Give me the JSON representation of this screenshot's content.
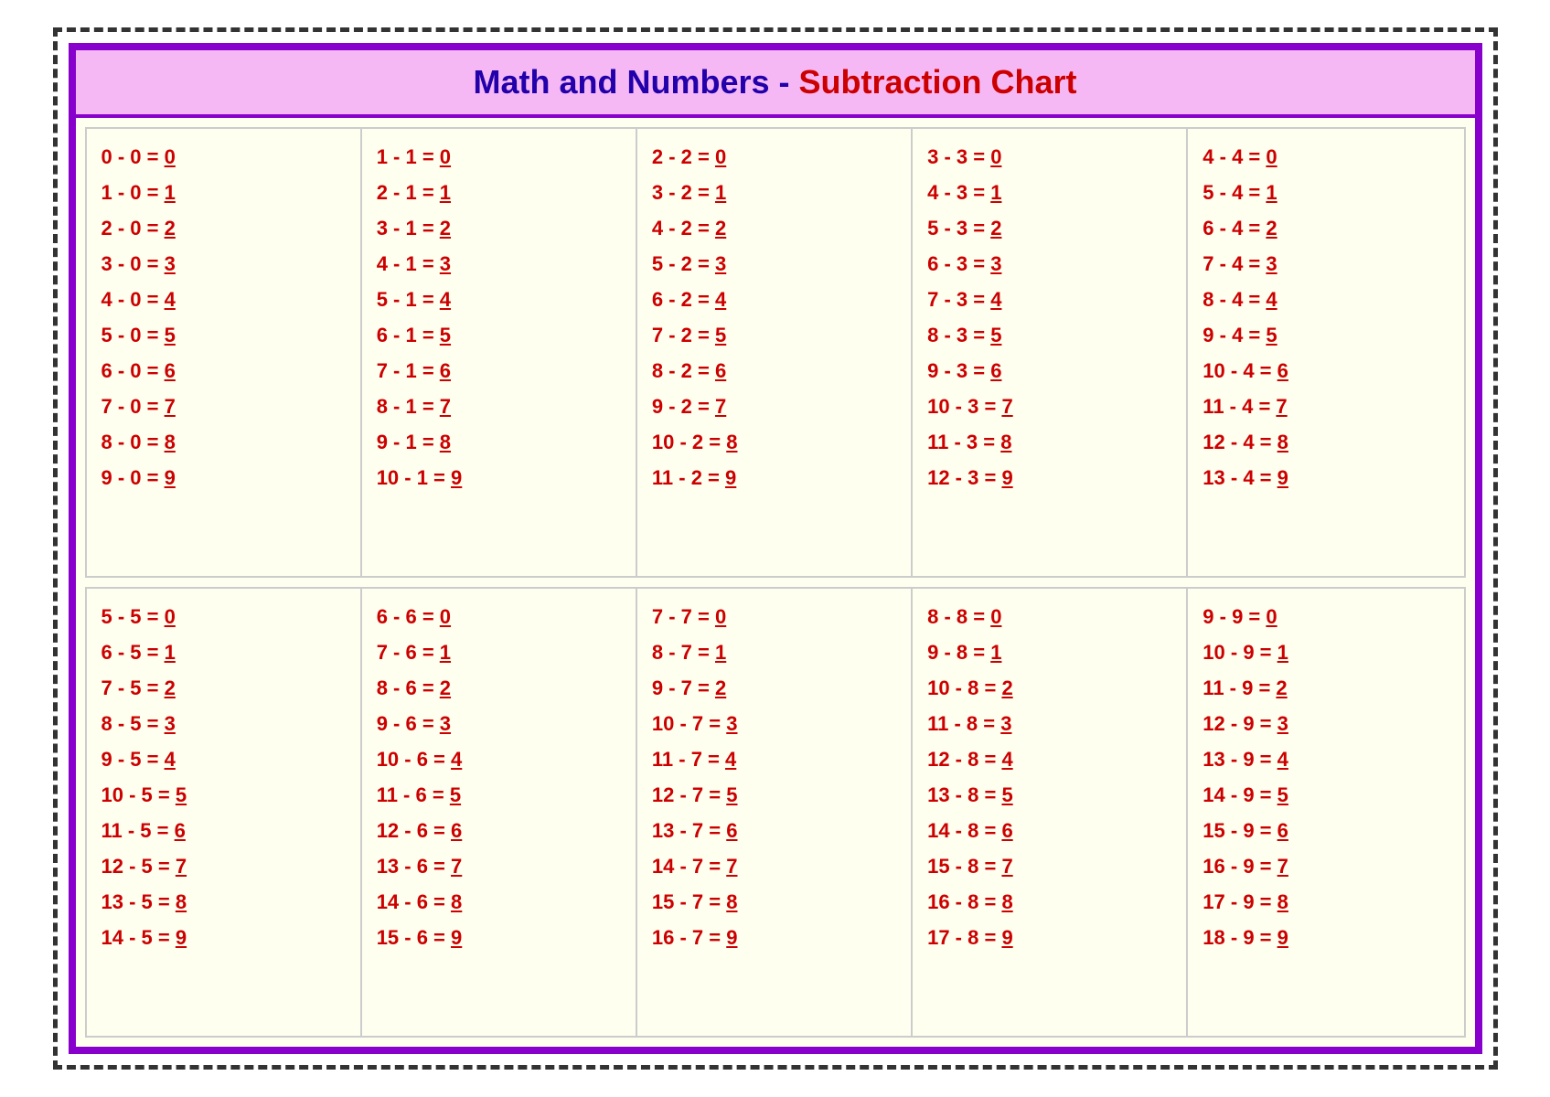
{
  "header": {
    "prefix": "Math and Numbers - ",
    "title": "Subtraction Chart"
  },
  "sections": [
    {
      "columns": [
        {
          "equations": [
            {
              "expression": "0 - 0 = ",
              "answer": "0"
            },
            {
              "expression": "1 - 0 = ",
              "answer": "1"
            },
            {
              "expression": "2 - 0 = ",
              "answer": "2"
            },
            {
              "expression": "3 - 0 = ",
              "answer": "3"
            },
            {
              "expression": "4 - 0 = ",
              "answer": "4"
            },
            {
              "expression": "5 - 0 = ",
              "answer": "5"
            },
            {
              "expression": "6 - 0 = ",
              "answer": "6"
            },
            {
              "expression": "7 - 0 = ",
              "answer": "7"
            },
            {
              "expression": "8 - 0 = ",
              "answer": "8"
            },
            {
              "expression": "9 - 0 = ",
              "answer": "9"
            }
          ]
        },
        {
          "equations": [
            {
              "expression": "1 - 1 = ",
              "answer": "0"
            },
            {
              "expression": "2 - 1 = ",
              "answer": "1"
            },
            {
              "expression": "3 - 1 = ",
              "answer": "2"
            },
            {
              "expression": "4 - 1 = ",
              "answer": "3"
            },
            {
              "expression": "5 - 1 = ",
              "answer": "4"
            },
            {
              "expression": "6 - 1 = ",
              "answer": "5"
            },
            {
              "expression": "7 - 1 = ",
              "answer": "6"
            },
            {
              "expression": "8 - 1 = ",
              "answer": "7"
            },
            {
              "expression": "9 - 1 = ",
              "answer": "8"
            },
            {
              "expression": "10 - 1 = ",
              "answer": "9"
            }
          ]
        },
        {
          "equations": [
            {
              "expression": "2 - 2 = ",
              "answer": "0"
            },
            {
              "expression": "3 - 2 = ",
              "answer": "1"
            },
            {
              "expression": "4 - 2 = ",
              "answer": "2"
            },
            {
              "expression": "5 - 2 = ",
              "answer": "3"
            },
            {
              "expression": "6 - 2 = ",
              "answer": "4"
            },
            {
              "expression": "7 - 2 = ",
              "answer": "5"
            },
            {
              "expression": "8 - 2 = ",
              "answer": "6"
            },
            {
              "expression": "9 - 2 = ",
              "answer": "7"
            },
            {
              "expression": "10 - 2 = ",
              "answer": "8"
            },
            {
              "expression": "11 - 2 = ",
              "answer": "9"
            }
          ]
        },
        {
          "equations": [
            {
              "expression": "3 - 3 = ",
              "answer": "0"
            },
            {
              "expression": "4 - 3 = ",
              "answer": "1"
            },
            {
              "expression": "5 - 3 = ",
              "answer": "2"
            },
            {
              "expression": "6 - 3 = ",
              "answer": "3"
            },
            {
              "expression": "7 - 3 = ",
              "answer": "4"
            },
            {
              "expression": "8 - 3 = ",
              "answer": "5"
            },
            {
              "expression": "9 - 3 = ",
              "answer": "6"
            },
            {
              "expression": "10 - 3 = ",
              "answer": "7"
            },
            {
              "expression": "11 - 3 = ",
              "answer": "8"
            },
            {
              "expression": "12 - 3 = ",
              "answer": "9"
            }
          ]
        },
        {
          "equations": [
            {
              "expression": "4 - 4 = ",
              "answer": "0"
            },
            {
              "expression": "5 - 4 = ",
              "answer": "1"
            },
            {
              "expression": "6 - 4 = ",
              "answer": "2"
            },
            {
              "expression": "7 - 4 = ",
              "answer": "3"
            },
            {
              "expression": "8 - 4 = ",
              "answer": "4"
            },
            {
              "expression": "9 - 4 = ",
              "answer": "5"
            },
            {
              "expression": "10 - 4 = ",
              "answer": "6"
            },
            {
              "expression": "11 - 4 = ",
              "answer": "7"
            },
            {
              "expression": "12 - 4 = ",
              "answer": "8"
            },
            {
              "expression": "13 - 4 = ",
              "answer": "9"
            }
          ]
        }
      ]
    },
    {
      "columns": [
        {
          "equations": [
            {
              "expression": "5 - 5 = ",
              "answer": "0"
            },
            {
              "expression": "6 - 5 = ",
              "answer": "1"
            },
            {
              "expression": "7 - 5 = ",
              "answer": "2"
            },
            {
              "expression": "8 - 5 = ",
              "answer": "3"
            },
            {
              "expression": "9 - 5 = ",
              "answer": "4"
            },
            {
              "expression": "10 - 5 = ",
              "answer": "5"
            },
            {
              "expression": "11 - 5 = ",
              "answer": "6"
            },
            {
              "expression": "12 - 5 = ",
              "answer": "7"
            },
            {
              "expression": "13 - 5 = ",
              "answer": "8"
            },
            {
              "expression": "14 - 5 = ",
              "answer": "9"
            }
          ]
        },
        {
          "equations": [
            {
              "expression": "6 - 6 = ",
              "answer": "0"
            },
            {
              "expression": "7 - 6 = ",
              "answer": "1"
            },
            {
              "expression": "8 - 6 = ",
              "answer": "2"
            },
            {
              "expression": "9 - 6 = ",
              "answer": "3"
            },
            {
              "expression": "10 - 6 = ",
              "answer": "4"
            },
            {
              "expression": "11 - 6 = ",
              "answer": "5"
            },
            {
              "expression": "12 - 6 = ",
              "answer": "6"
            },
            {
              "expression": "13 - 6 = ",
              "answer": "7"
            },
            {
              "expression": "14 - 6 = ",
              "answer": "8"
            },
            {
              "expression": "15 - 6 = ",
              "answer": "9"
            }
          ]
        },
        {
          "equations": [
            {
              "expression": "7 - 7 = ",
              "answer": "0"
            },
            {
              "expression": "8 - 7 = ",
              "answer": "1"
            },
            {
              "expression": "9 - 7 = ",
              "answer": "2"
            },
            {
              "expression": "10 - 7 = ",
              "answer": "3"
            },
            {
              "expression": "11 - 7 = ",
              "answer": "4"
            },
            {
              "expression": "12 - 7 = ",
              "answer": "5"
            },
            {
              "expression": "13 - 7 = ",
              "answer": "6"
            },
            {
              "expression": "14 - 7 = ",
              "answer": "7"
            },
            {
              "expression": "15 - 7 = ",
              "answer": "8"
            },
            {
              "expression": "16 - 7 = ",
              "answer": "9"
            }
          ]
        },
        {
          "equations": [
            {
              "expression": "8 - 8 = ",
              "answer": "0"
            },
            {
              "expression": "9 - 8 = ",
              "answer": "1"
            },
            {
              "expression": "10 - 8 = ",
              "answer": "2"
            },
            {
              "expression": "11 - 8 = ",
              "answer": "3"
            },
            {
              "expression": "12 - 8 = ",
              "answer": "4"
            },
            {
              "expression": "13 - 8 = ",
              "answer": "5"
            },
            {
              "expression": "14 - 8 = ",
              "answer": "6"
            },
            {
              "expression": "15 - 8 = ",
              "answer": "7"
            },
            {
              "expression": "16 - 8 = ",
              "answer": "8"
            },
            {
              "expression": "17 - 8 = ",
              "answer": "9"
            }
          ]
        },
        {
          "equations": [
            {
              "expression": "9 - 9 = ",
              "answer": "0"
            },
            {
              "expression": "10 - 9 = ",
              "answer": "1"
            },
            {
              "expression": "11 - 9 = ",
              "answer": "2"
            },
            {
              "expression": "12 - 9 = ",
              "answer": "3"
            },
            {
              "expression": "13 - 9 = ",
              "answer": "4"
            },
            {
              "expression": "14 - 9 = ",
              "answer": "5"
            },
            {
              "expression": "15 - 9 = ",
              "answer": "6"
            },
            {
              "expression": "16 - 9 = ",
              "answer": "7"
            },
            {
              "expression": "17 - 9 = ",
              "answer": "8"
            },
            {
              "expression": "18 - 9 = ",
              "answer": "9"
            }
          ]
        }
      ]
    }
  ]
}
